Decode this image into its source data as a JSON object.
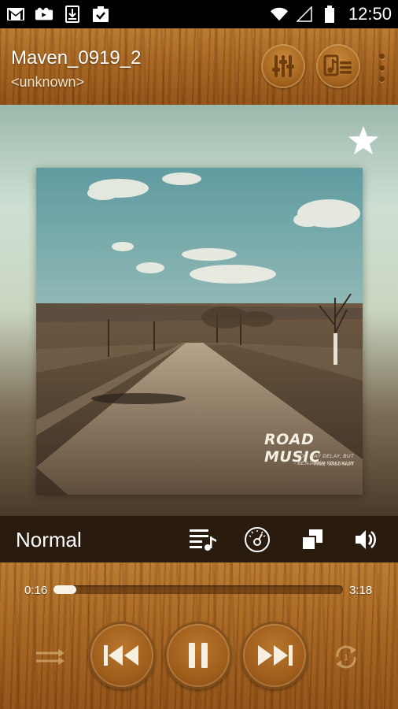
{
  "status_bar": {
    "time": "12:50",
    "left_icons": [
      "gmail-icon",
      "video-icon",
      "download-icon",
      "clipboard-check-icon"
    ],
    "right_icons": [
      "wifi-icon",
      "signal-icon",
      "battery-icon"
    ]
  },
  "header": {
    "title": "Maven_0919_2",
    "artist": "<unknown>",
    "buttons": [
      "equalizer-icon",
      "music-list-icon",
      "more-options-icon"
    ]
  },
  "album": {
    "favorite_icon": "star-icon",
    "cover_title": "ROAD MUSIC",
    "cover_quote": "YOU MAY DELAY, BUT TIME WILL NOT",
    "cover_author": "- BENJAMIN FRANKLIN"
  },
  "control_bar": {
    "mode": "Normal",
    "icons": [
      "playlist-icon",
      "sound-alive-icon",
      "mini-player-icon",
      "volume-icon"
    ]
  },
  "player": {
    "current_time": "0:16",
    "total_time": "3:18",
    "progress": 0.08,
    "controls": [
      "shuffle-icon",
      "previous-icon",
      "pause-icon",
      "next-icon",
      "repeat-one-icon"
    ]
  },
  "colors": {
    "wood": "#a4631f",
    "wood_dark": "#6f3a09",
    "control_bar": "#2a1b0f",
    "knob_dark": "#6e3d0d"
  }
}
